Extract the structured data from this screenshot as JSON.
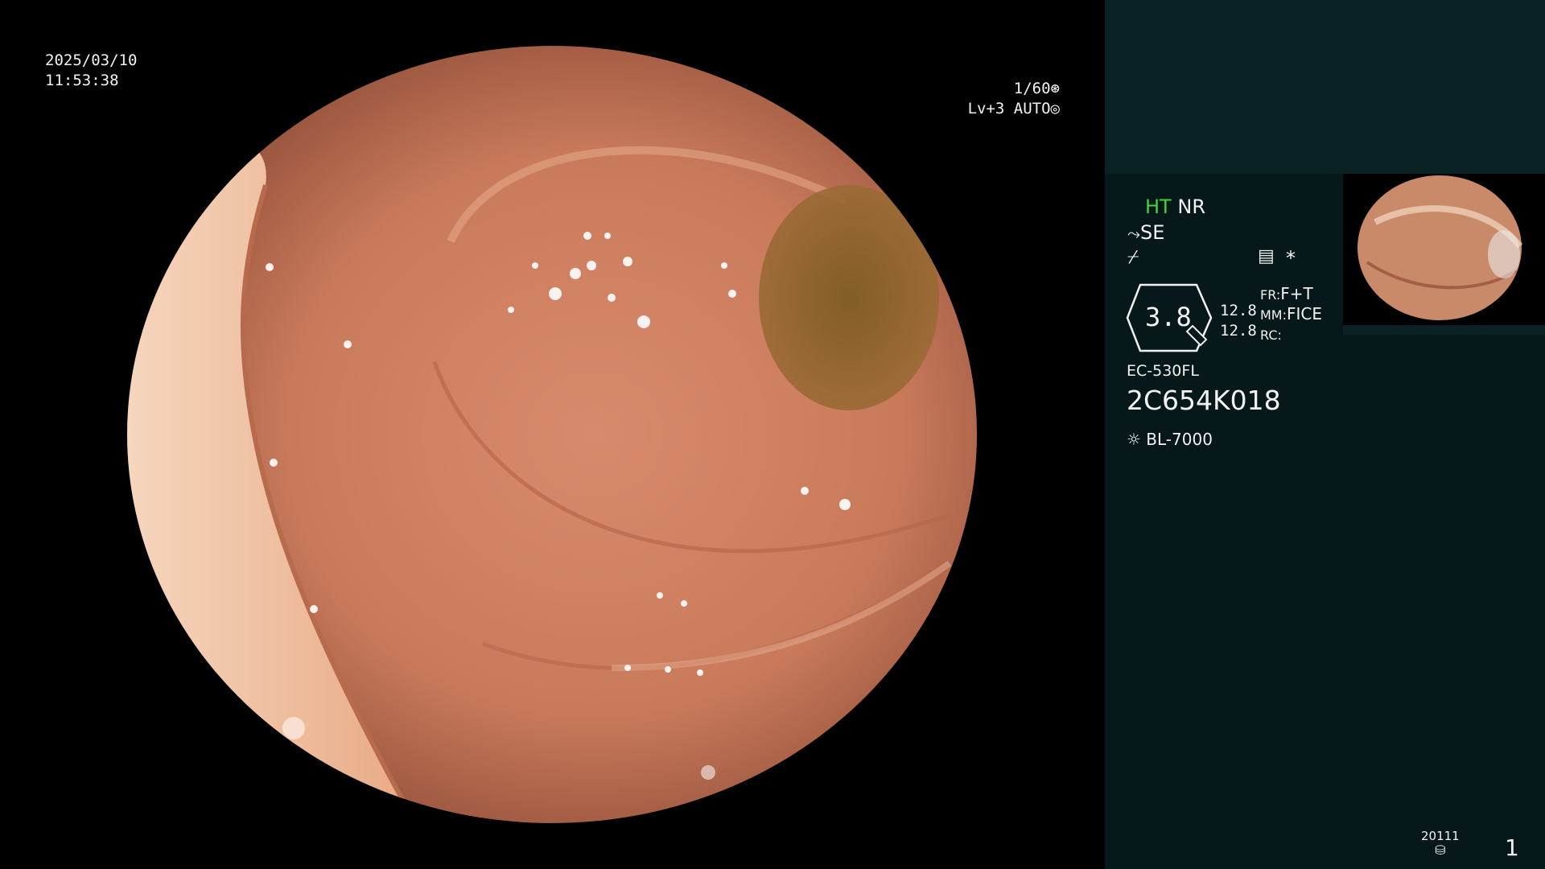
{
  "overlay": {
    "date": "2025/03/10",
    "time": "11:53:38",
    "shutter": "1/60",
    "level": "Lv+3 AUTO",
    "shutter_icon": "aperture-icon",
    "auto_icon": "iris-icon"
  },
  "panel": {
    "mode_ht": "HT",
    "mode_nr": "NR",
    "se_label": "SE",
    "scale_value": "3.8",
    "value1": "12.8",
    "value2": "12.8",
    "fr_label": "FR:",
    "fr_value": "F+T",
    "mm_label": "MM:",
    "mm_value": "FICE",
    "rc_label": "RC:",
    "asterisk": "*",
    "scope_model": "EC-530FL",
    "scope_serial": "2C654K018",
    "light_source": "BL-7000",
    "storage_count": "20111",
    "page_number": "1"
  },
  "colors": {
    "panel_bg": "#07181a",
    "panel_top_bg": "#0b2224",
    "mode_ht": "#41d63a",
    "mucosa": "#c47a5c"
  }
}
